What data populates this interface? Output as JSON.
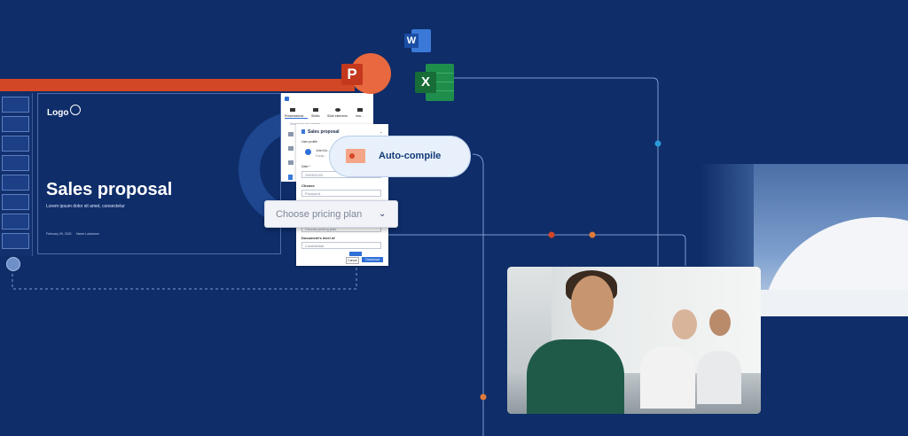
{
  "slide": {
    "logo": "Logo",
    "title": "Sales proposal",
    "subtitle": "Lorem ipsum dolor sit amet, consectetur",
    "date": "February 09, 2020",
    "author": "Name Lastname"
  },
  "panel": {
    "tabs": [
      "Presentations",
      "Slides",
      "Slide elements",
      "Ima..."
    ],
    "search_placeholder": "Search for documents",
    "doc_title": "Sales proposal",
    "user_profile_label": "User profile",
    "user_name": "John Do...",
    "user_company": "Comp...",
    "date_label": "Date *",
    "date_value": "29/09/2020",
    "choose_label": "Choose",
    "choose_value": "Product A",
    "pricing_value": "Choose pricing plan",
    "level_label": "Document's level of",
    "level_value": "Confidential",
    "cancel_label": "Cancel",
    "download_label": "Download"
  },
  "dropdown": {
    "placeholder": "Choose pricing plan",
    "chevron": "chevron-down-icon"
  },
  "autocompile": {
    "label": "Auto-compile",
    "icon": "slide-thumbnail-icon"
  },
  "apps": {
    "word": "W",
    "powerpoint": "P",
    "excel": "X"
  },
  "colors": {
    "background": "#0f2d69",
    "accent_orange": "#d24726",
    "connector": "#7f9bd0",
    "dot_blue": "#2a9bd8",
    "dot_orange": "#e07a3a"
  }
}
